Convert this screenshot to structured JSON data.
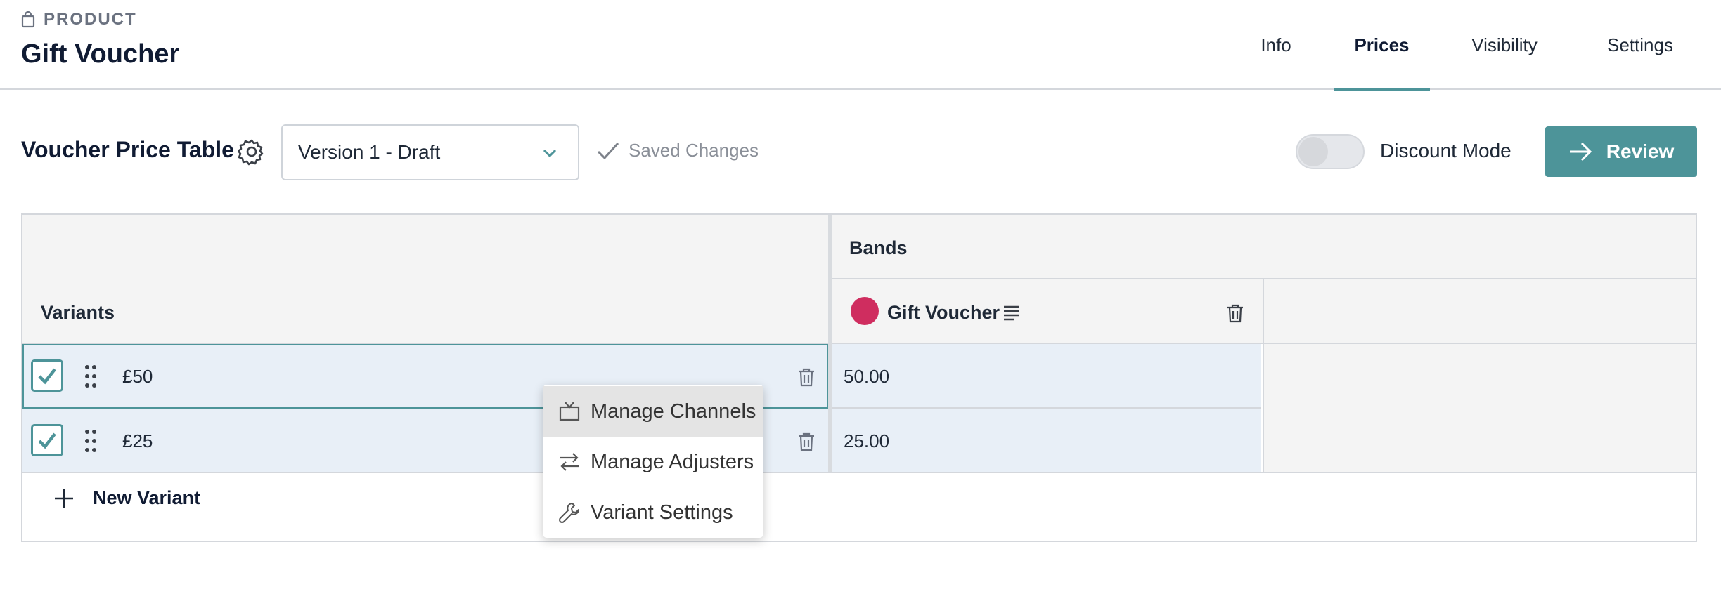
{
  "header": {
    "eyebrow": "PRODUCT",
    "title": "Gift Voucher",
    "tabs": [
      {
        "label": "Info"
      },
      {
        "label": "Prices"
      },
      {
        "label": "Visibility"
      },
      {
        "label": "Settings"
      }
    ],
    "active_tab": "Prices"
  },
  "toolbar": {
    "title": "Voucher Price Table",
    "version_select": "Version 1 - Draft",
    "saved_status": "Saved Changes",
    "discount_toggle_label": "Discount Mode",
    "discount_mode_on": false,
    "review_label": "Review"
  },
  "table": {
    "bands_header": "Bands",
    "variants_header": "Variants",
    "band": {
      "name": "Gift Voucher",
      "color": "#cf2d5f"
    },
    "rows": [
      {
        "label": "£50",
        "price": "50.00",
        "checked": true
      },
      {
        "label": "£25",
        "price": "25.00",
        "checked": true
      }
    ],
    "new_variant_label": "New Variant"
  },
  "context_menu": {
    "items": [
      {
        "label": "Manage Channels",
        "icon": "tv-icon"
      },
      {
        "label": "Manage Adjusters",
        "icon": "arrows-swap-icon"
      },
      {
        "label": "Variant Settings",
        "icon": "wrench-icon"
      }
    ]
  },
  "colors": {
    "accent": "#4d9499",
    "title": "#101b33",
    "band_dot": "#cf2d5f",
    "selected_row": "#e8eff7"
  }
}
